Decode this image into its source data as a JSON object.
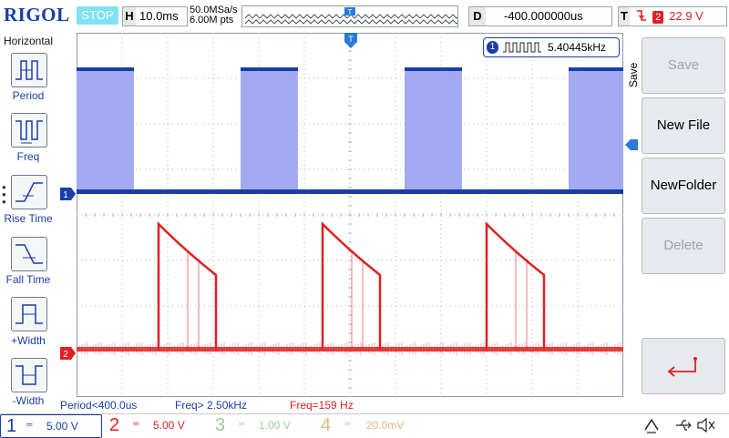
{
  "header": {
    "brand": "RIGOL",
    "run_state": "STOP",
    "timebase_key": "H",
    "timebase_value": "10.0ms",
    "sample_rate": "50.0MSa/s",
    "memory_depth": "6.00M pts",
    "trigger_pos_marker": "T",
    "delay_key": "D",
    "delay_value": "-400.000000us",
    "trigger_key": "T",
    "trigger_channel": "2",
    "trigger_level": "22.9 V"
  },
  "left_menu": {
    "title": "Horizontal",
    "items": [
      {
        "label": "Period"
      },
      {
        "label": "Freq"
      },
      {
        "label": "Rise Time"
      },
      {
        "label": "Fall Time"
      },
      {
        "label": "+Width"
      },
      {
        "label": "-Width"
      }
    ]
  },
  "frequency_counter": {
    "channel": "1",
    "value": "5.40445kHz"
  },
  "traces": {
    "ch1_marker": "1",
    "ch2_marker": "2",
    "trigger_marker": "T"
  },
  "right_menu": {
    "tab_label": "Save",
    "buttons": [
      {
        "label": "Save",
        "enabled": false
      },
      {
        "label": "New File",
        "enabled": true
      },
      {
        "label": "NewFolder",
        "enabled": true
      },
      {
        "label": "Delete",
        "enabled": false
      }
    ]
  },
  "measurements": {
    "period": "Period<400.0us",
    "freq1": "Freq> 2.50kHz",
    "freq2": "Freq=159 Hz"
  },
  "channels": [
    {
      "num": "1",
      "scale": "5.00 V",
      "color": "#1a3ea8"
    },
    {
      "num": "2",
      "scale": "5.00 V",
      "color": "#e02020"
    },
    {
      "num": "3",
      "scale": "1.00 V",
      "color": "#7cc07c"
    },
    {
      "num": "4",
      "scale": "20.0mV",
      "color": "#d89a40"
    }
  ],
  "colors": {
    "ch1": "#1a3ea8",
    "ch1_fill": "#a8b0f4",
    "ch2": "#e02020",
    "accent": "#1a3ea8",
    "status_stop": "#7fe3f2"
  }
}
